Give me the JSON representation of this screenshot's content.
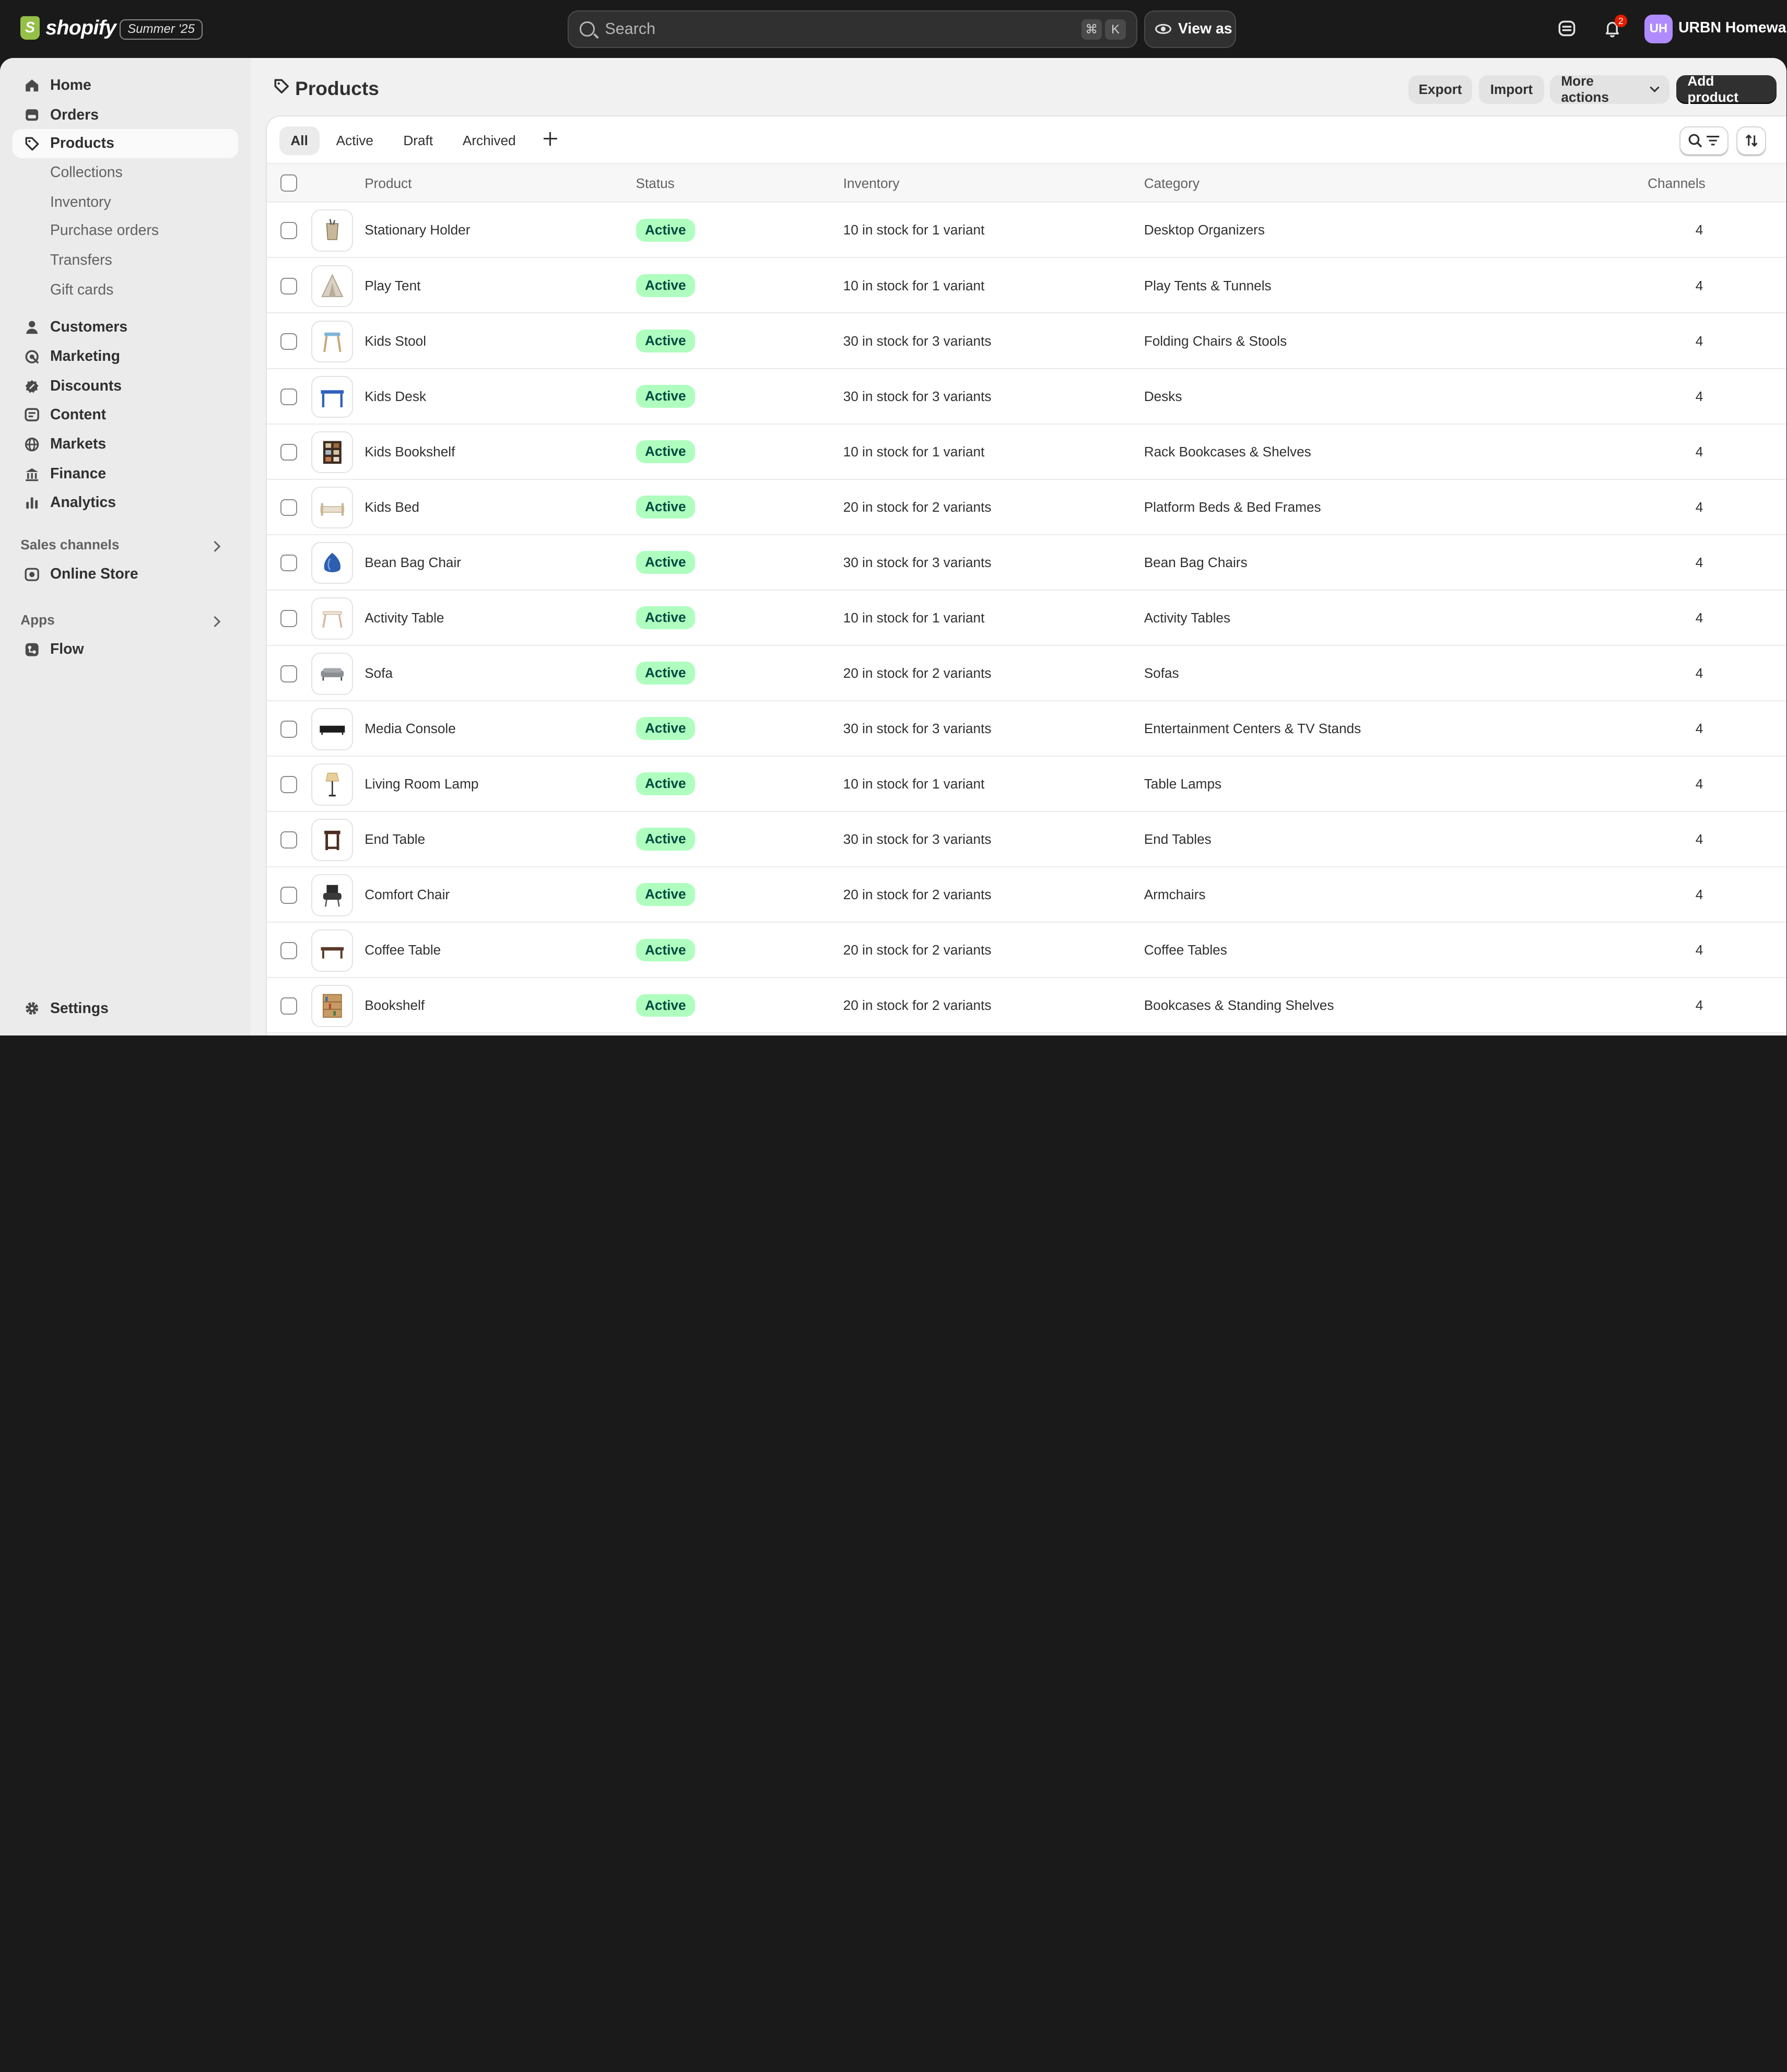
{
  "topbar": {
    "logo_text": "shopify",
    "edition": "Summer '25",
    "search_placeholder": "Search",
    "shortcut_cmd": "⌘",
    "shortcut_key": "K",
    "view_as": "View as",
    "notification_count": "2",
    "avatar_initials": "UH",
    "store_name": "URBN Homewares"
  },
  "sidebar": {
    "items": [
      {
        "label": "Home",
        "icon": "home-icon"
      },
      {
        "label": "Orders",
        "icon": "orders-icon"
      },
      {
        "label": "Products",
        "icon": "tag-icon"
      }
    ],
    "product_sub": [
      "Collections",
      "Inventory",
      "Purchase orders",
      "Transfers",
      "Gift cards"
    ],
    "items2": [
      {
        "label": "Customers",
        "icon": "person-icon"
      },
      {
        "label": "Marketing",
        "icon": "target-icon"
      },
      {
        "label": "Discounts",
        "icon": "discount-icon"
      },
      {
        "label": "Content",
        "icon": "content-icon"
      },
      {
        "label": "Markets",
        "icon": "globe-icon"
      },
      {
        "label": "Finance",
        "icon": "bank-icon"
      },
      {
        "label": "Analytics",
        "icon": "chart-icon"
      }
    ],
    "sales_channels_label": "Sales channels",
    "online_store": "Online Store",
    "apps_label": "Apps",
    "flow": "Flow",
    "settings": "Settings"
  },
  "page": {
    "title": "Products",
    "export": "Export",
    "import": "Import",
    "more_actions": "More actions",
    "add_product": "Add product"
  },
  "tabs": [
    "All",
    "Active",
    "Draft",
    "Archived"
  ],
  "table": {
    "headers": {
      "product": "Product",
      "status": "Status",
      "inventory": "Inventory",
      "category": "Category",
      "channels": "Channels"
    },
    "rows": [
      {
        "product": "Stationary Holder",
        "status": "Active",
        "inventory": "10 in stock for 1 variant",
        "category": "Desktop Organizers",
        "channels": "4"
      },
      {
        "product": "Play Tent",
        "status": "Active",
        "inventory": "10 in stock for 1 variant",
        "category": "Play Tents & Tunnels",
        "channels": "4"
      },
      {
        "product": "Kids Stool",
        "status": "Active",
        "inventory": "30 in stock for 3 variants",
        "category": "Folding Chairs & Stools",
        "channels": "4"
      },
      {
        "product": "Kids Desk",
        "status": "Active",
        "inventory": "30 in stock for 3 variants",
        "category": "Desks",
        "channels": "4"
      },
      {
        "product": "Kids Bookshelf",
        "status": "Active",
        "inventory": "10 in stock for 1 variant",
        "category": "Rack Bookcases & Shelves",
        "channels": "4"
      },
      {
        "product": "Kids Bed",
        "status": "Active",
        "inventory": "20 in stock for 2 variants",
        "category": "Platform Beds & Bed Frames",
        "channels": "4"
      },
      {
        "product": "Bean Bag Chair",
        "status": "Active",
        "inventory": "30 in stock for 3 variants",
        "category": "Bean Bag Chairs",
        "channels": "4"
      },
      {
        "product": "Activity Table",
        "status": "Active",
        "inventory": "10 in stock for 1 variant",
        "category": "Activity Tables",
        "channels": "4"
      },
      {
        "product": "Sofa",
        "status": "Active",
        "inventory": "20 in stock for 2 variants",
        "category": "Sofas",
        "channels": "4"
      },
      {
        "product": "Media Console",
        "status": "Active",
        "inventory": "30 in stock for 3 variants",
        "category": "Entertainment Centers & TV Stands",
        "channels": "4"
      },
      {
        "product": "Living Room Lamp",
        "status": "Active",
        "inventory": "10 in stock for 1 variant",
        "category": "Table Lamps",
        "channels": "4"
      },
      {
        "product": "End Table",
        "status": "Active",
        "inventory": "30 in stock for 3 variants",
        "category": "End Tables",
        "channels": "4"
      },
      {
        "product": "Comfort Chair",
        "status": "Active",
        "inventory": "20 in stock for 2 variants",
        "category": "Armchairs",
        "channels": "4"
      },
      {
        "product": "Coffee Table",
        "status": "Active",
        "inventory": "20 in stock for 2 variants",
        "category": "Coffee Tables",
        "channels": "4"
      },
      {
        "product": "Bookshelf",
        "status": "Active",
        "inventory": "20 in stock for 2 variants",
        "category": "Bookcases & Standing Shelves",
        "channels": "4"
      }
    ]
  },
  "colors": {
    "topbar_bg": "#1a1a1a",
    "status_bg": "#affebf",
    "status_text": "#014b40",
    "primary_btn": "#303030",
    "shopify_green": "#95bf47"
  }
}
